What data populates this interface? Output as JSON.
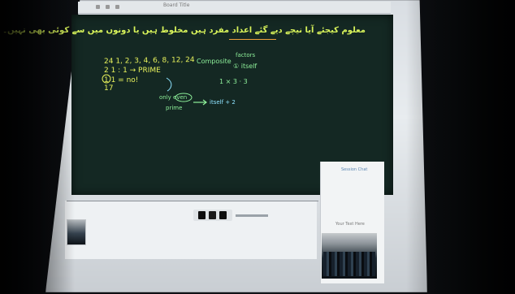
{
  "window": {
    "title": "Board Title"
  },
  "heading": {
    "urdu": "معلوم کیجئے آیا نیچے دیے گئے اعداد مفرد ہیں مخلوط ہیں یا دونوں میں سے کوئی بھی نہیں۔"
  },
  "board": {
    "line1_yellow": "24   1, 2, 3, 4, 6, 8, 12, 24",
    "line2_yellow": "2     1 : 1  → PRIME",
    "line3_yellow": "1    1 = no!",
    "line4_yellow": "17",
    "composite": "Composite",
    "factors": "factors",
    "itself": "① itself",
    "equation": "1 × 3 · 3",
    "only_even": "only  even",
    "prime": "prime",
    "itself_2": "itself  +  2"
  },
  "sidebar": {
    "session_title": "Session Chat",
    "label": "Your Text Here"
  },
  "controls": {
    "icons": [
      "previous-icon",
      "pause-icon",
      "next-icon"
    ]
  }
}
